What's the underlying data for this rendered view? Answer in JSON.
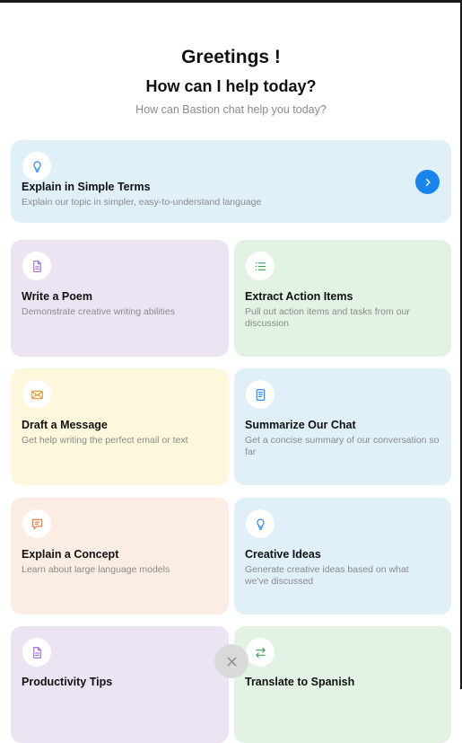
{
  "header": {
    "greeting": "Greetings !",
    "question": "How can I help today?",
    "subtitle": "How can Bastion chat help you today?"
  },
  "cards": [
    {
      "title": "Explain in Simple Terms",
      "description": "Explain our topic in simpler, easy-to-understand language",
      "icon": "lightbulb-icon",
      "color": "#dff0f8"
    },
    {
      "title": "Write a Poem",
      "description": "Demonstrate creative writing abilities",
      "icon": "document-icon",
      "color": "#ede4f3"
    },
    {
      "title": "Extract Action Items",
      "description": "Pull out action items and tasks from our discussion",
      "icon": "list-icon",
      "color": "#e3f3e3"
    },
    {
      "title": "Draft a Message",
      "description": "Get help writing the perfect email or text",
      "icon": "envelope-icon",
      "color": "#fdf7dc"
    },
    {
      "title": "Summarize Our Chat",
      "description": "Get a concise summary of our conversation so far",
      "icon": "summary-document-icon",
      "color": "#dff0f8"
    },
    {
      "title": "Explain a Concept",
      "description": "Learn about large language models",
      "icon": "chat-bubble-icon",
      "color": "#fcede4"
    },
    {
      "title": "Creative Ideas",
      "description": "Generate creative ideas based on what we've discussed",
      "icon": "lightbulb-icon",
      "color": "#dff0f8"
    },
    {
      "title": "Productivity Tips",
      "description": "",
      "icon": "document-icon",
      "color": "#ede4f3"
    },
    {
      "title": "Translate to Spanish",
      "description": "",
      "icon": "swap-arrows-icon",
      "color": "#e3f3e3"
    }
  ],
  "colors": {
    "accent": "#1a84ee",
    "icon_blue": "#1a84ee",
    "icon_purple": "#9b6ad6",
    "icon_green": "#3f9e56",
    "icon_orange": "#e39a2b",
    "icon_peach": "#e07a3a"
  }
}
